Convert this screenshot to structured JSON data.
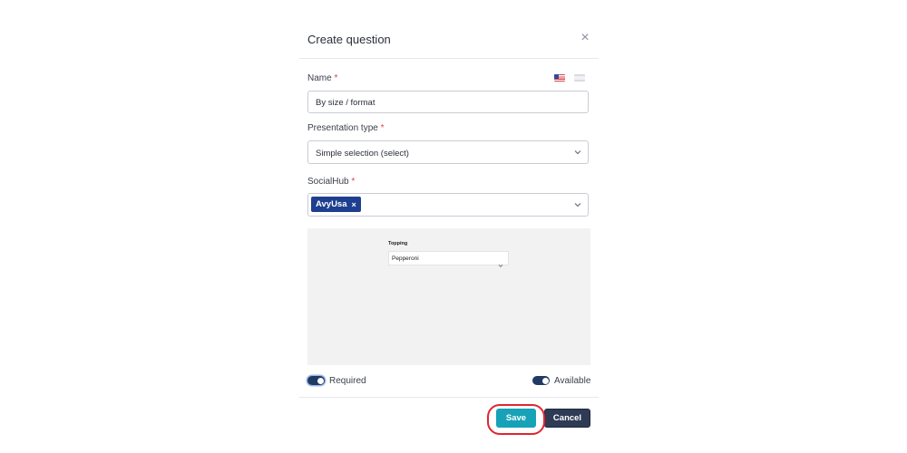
{
  "dialog": {
    "title": "Create question",
    "close_symbol": "×"
  },
  "fields": {
    "name_label": "Name",
    "name_value": "By size / format",
    "presentation_label": "Presentation type",
    "presentation_value": "Simple selection (select)",
    "socialhub_label": "SocialHub",
    "socialhub_tags": [
      "AvyUsa"
    ],
    "required_marker": "*"
  },
  "languages": [
    "flag-us-icon",
    "flag-other-icon"
  ],
  "preview": {
    "label": "Topping",
    "selected": "Pepperoni"
  },
  "toggles": {
    "required_label": "Required",
    "required_on": true,
    "available_label": "Available",
    "available_on": true
  },
  "buttons": {
    "save": "Save",
    "cancel": "Cancel"
  },
  "colors": {
    "tag_bg": "#1e3f8f",
    "save_bg": "#17a2b8",
    "cancel_bg": "#2f3b55",
    "toggle_bg": "#1f3a63",
    "required_asterisk": "#e0414f",
    "highlight": "#e0262f"
  }
}
